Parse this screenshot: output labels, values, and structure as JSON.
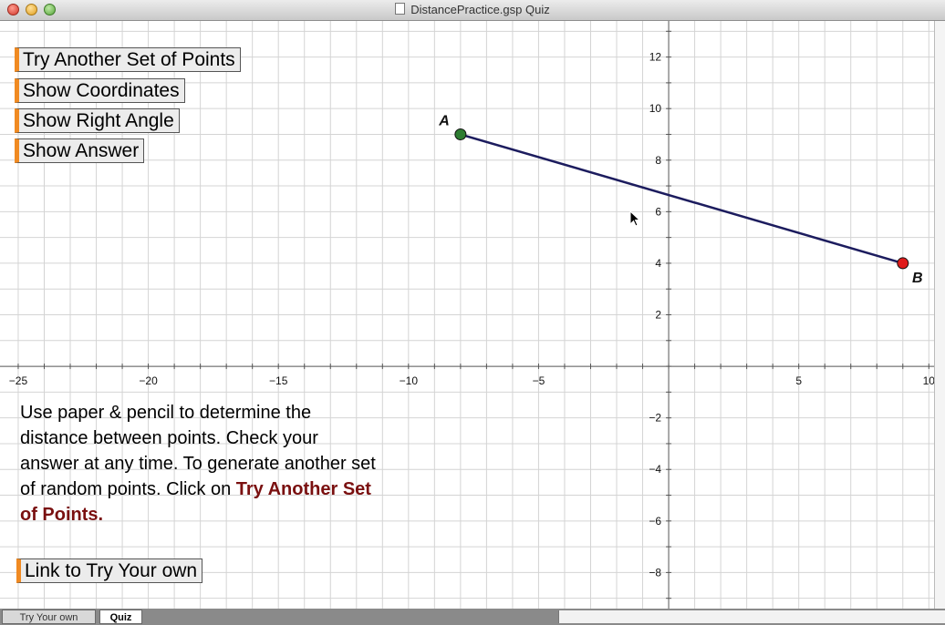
{
  "window": {
    "title": "DistancePractice.gsp  Quiz"
  },
  "buttons": {
    "try_another": "Try Another Set of Points",
    "show_coordinates": "Show Coordinates",
    "show_right_angle": "Show Right Angle",
    "show_answer": "Show Answer",
    "link_try_own": "Link to Try Your own"
  },
  "instructions": {
    "text": "Use paper & pencil to determine the distance between points. Check your answer at any time. To generate another set of random points. Click on ",
    "emphasis": "Try Another Set of Points."
  },
  "tabs": [
    {
      "label": "Try Your own",
      "active": false
    },
    {
      "label": "Quiz",
      "active": true
    }
  ],
  "chart_data": {
    "type": "scatter",
    "xlim": [
      -25.7,
      10.2
    ],
    "ylim": [
      -9.4,
      13.4
    ],
    "x_ticks": [
      -25,
      -20,
      -15,
      -10,
      -5,
      5,
      10
    ],
    "y_ticks": [
      -8,
      -6,
      -4,
      -2,
      2,
      4,
      6,
      8,
      10,
      12
    ],
    "grid": true,
    "points": [
      {
        "label": "A",
        "x": -8,
        "y": 9,
        "color": "#2e7d32"
      },
      {
        "label": "B",
        "x": 9,
        "y": 4,
        "color": "#e01b1b"
      }
    ],
    "segment": {
      "from": "A",
      "to": "B",
      "color": "#1c1c5e"
    }
  }
}
